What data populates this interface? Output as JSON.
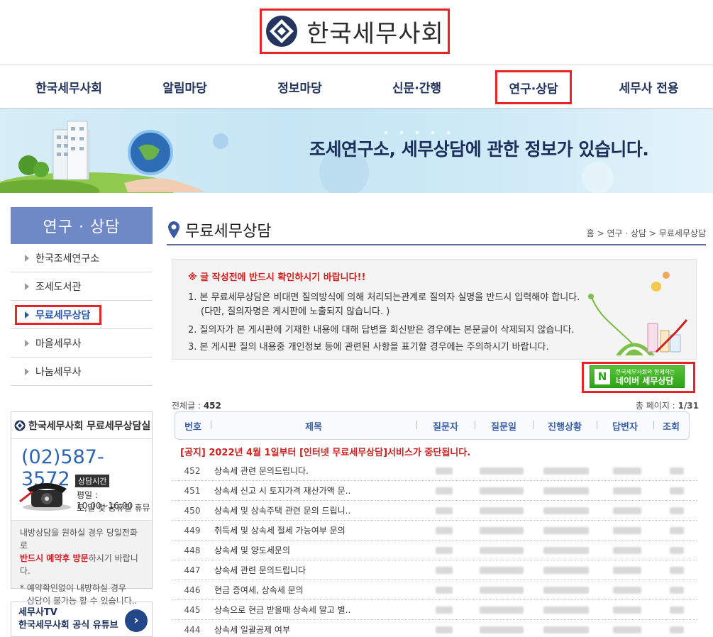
{
  "header": {
    "logo_text": "한국세무사회",
    "nav": [
      "한국세무사회",
      "알림마당",
      "정보마당",
      "신문·간행",
      "연구·상담",
      "세무사 전용"
    ],
    "active_nav": "연구·상담"
  },
  "banner": {
    "text": "조세연구소, 세무상담에 관한 정보가 있습니다."
  },
  "sidebar": {
    "title": "연구 · 상담",
    "items": [
      "한국조세연구소",
      "조세도서관",
      "무료세무상담",
      "마을세무사",
      "나눔세무사"
    ],
    "active": "무료세무상담",
    "call": {
      "heading": "한국세무사회 무료세무상담실",
      "number": "(02)587-3572",
      "hours_label": "상담시간",
      "hours_weekday": "평일 : 10:00~16:00",
      "hours_weekend": "토,일 및 공휴일 휴뮤",
      "visit_pre": "내방상담을 원하실 경우 당일전화로",
      "visit_red": "반드시 예약후 방문",
      "visit_post": "하시기 바랍니다.",
      "note1": "* 예약확인없이 내방하실 경우",
      "note2": "상담이 불가능 할 수 있습니다.."
    },
    "tv": {
      "line1": "세무사TV",
      "line2": "한국세무사회 공식 유튜브",
      "arrow": "›"
    }
  },
  "content": {
    "title": "무료세무상담",
    "breadcrumb": "홈 > 연구 · 상담 > 무료세무상담",
    "notice": {
      "warn": "※ 글 작성전에 반드시 확인하시기 바랍니다!!",
      "line1": "1. 본 무료세무상담은 비대면 질의방식에 의해 처리되는관계로 질의자 실명을 반드시 입력해야 합니다.",
      "line1b": "(다만, 질의자명은 게시판에 노출되지 않습니다. )",
      "line2": "2. 질의자가 본 게시판에 기재한 내용에 대해 답변을 회신받은 경우에는 본문글이 삭제되지 않습니다.",
      "line3": "3. 본 게시판 질의 내용중 개인정보 등에 관련된 사항을 표기할 경우에는 주의하시기 바랍니다."
    },
    "naver": {
      "n": "N",
      "small": "한국세무사회와 함께하는",
      "big": "네이버 세무상담"
    },
    "total_label": "전체글 :",
    "total_value": "452",
    "page_label": "총 페이지 :",
    "page_value": "1/31",
    "columns": [
      "번호",
      "제목",
      "질문자",
      "질문일",
      "진행상황",
      "답변자",
      "조회"
    ],
    "notice_row": "[공지] 2022년 4월 1일부터 [인터넷 무료세무상담]서비스가 중단됩니다.",
    "rows": [
      {
        "num": "452",
        "subject": "상속세 관련 문의드립니다."
      },
      {
        "num": "451",
        "subject": "상속세 신고 시 토지가격 재산가액 문.."
      },
      {
        "num": "450",
        "subject": "상속세 및 상속주택 관련 문의 드립니.."
      },
      {
        "num": "449",
        "subject": "취득세 및 상속세 절세 가능여부 문의"
      },
      {
        "num": "448",
        "subject": "상속세 및 양도세문의"
      },
      {
        "num": "447",
        "subject": "상속세 관련 문의드립니다"
      },
      {
        "num": "446",
        "subject": "현금 증여세, 상속세 문의"
      },
      {
        "num": "445",
        "subject": "상속으로 현금 받을때 상속세 말고 별.."
      },
      {
        "num": "444",
        "subject": "상속세 일괄공제 여부"
      }
    ]
  },
  "colors": {
    "accent": "#e8242b",
    "brand": "#23355f",
    "lnb": "#6f88c6",
    "naver": "#2ea318"
  }
}
